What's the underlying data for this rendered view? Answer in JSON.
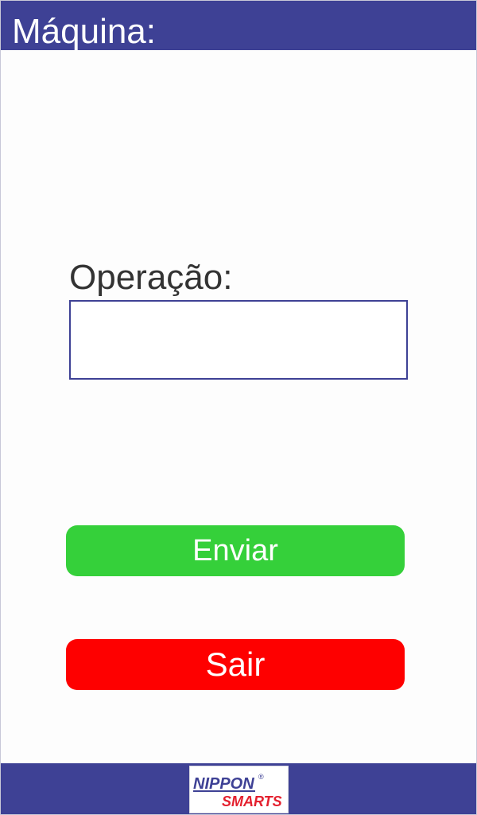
{
  "header": {
    "title": "Máquina:"
  },
  "form": {
    "operation_label": "Operação:",
    "operation_value": "",
    "operation_placeholder": ""
  },
  "actions": {
    "send_label": "Enviar",
    "exit_label": "Sair"
  },
  "footer": {
    "logo_line1": "NIPPON",
    "logo_line2": "SMARTS",
    "logo_registered": "®"
  },
  "colors": {
    "brand_blue": "#3e4195",
    "send_green": "#35d03a",
    "exit_red": "#fe0000",
    "logo_red": "#e4202e"
  }
}
